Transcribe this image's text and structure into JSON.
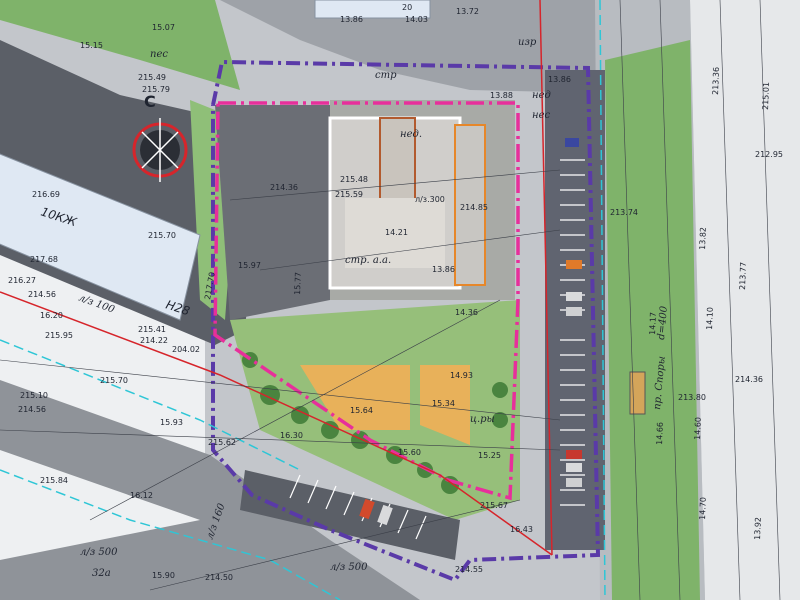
{
  "colors": {
    "road": "#4a4d55",
    "ground": "#a5a8ad",
    "green": "#7fb36a",
    "green_light": "#9fcb83",
    "playground": "#e8b15a",
    "building": "#c8c6c2",
    "boundary_magenta": "#e72f9b",
    "boundary_purple": "#5a3aa8",
    "red_line": "#d6252b",
    "cyan_line": "#2ec6d6"
  },
  "compass": {
    "letter": "С",
    "icon": "north-arrow-icon"
  },
  "buildings": [
    {
      "label": "10КЖ"
    },
    {
      "label": "Н28"
    },
    {
      "label": "20"
    }
  ],
  "main_building": {
    "label": "14.21",
    "top_label": "нед.",
    "mid_label": "л/з.300"
  },
  "labels": {
    "l1": "15.07",
    "l2": "15.15",
    "l3": "215.49",
    "l4": "215.79",
    "l5": "216.69",
    "l6": "215.70",
    "l7": "217.68",
    "l8": "216.27",
    "l9": "214.56",
    "l10": "16.20",
    "l11": "215.95",
    "l12": "215.41",
    "l13": "214.22",
    "l14": "204.02",
    "l15": "215.10",
    "l16": "214.56",
    "l17": "215.70",
    "l18": "15.93",
    "l19": "16.12",
    "l20": "15.90",
    "l21": "214.50",
    "l22": "215.84",
    "l23": "13.86",
    "l24": "14.03",
    "l25": "13.72",
    "l26": "13.86",
    "l27": "13.88",
    "l28": "214.36",
    "l29": "215.48",
    "l30": "215.59",
    "l31": "13.86",
    "l32": "14.36",
    "l33": "14.93",
    "l34": "15.34",
    "l35": "15.64",
    "l36": "15.25",
    "l37": "215.67",
    "l38": "16.43",
    "l39": "214.55",
    "l40": "15.60",
    "l41": "214.85",
    "l42": "213.74",
    "l43": "14.17",
    "l44": "14.66",
    "l45": "14.60",
    "l46": "14.70",
    "l47": "13.82",
    "l48": "213.77",
    "l49": "214.36",
    "l50": "213.80",
    "l51": "212.95",
    "l52": "215.01",
    "l53": "213.36",
    "l54": "14.10",
    "l55": "13.92",
    "l56": "215.62",
    "l57": "15.97",
    "l58": "15.77",
    "l59": "217.70",
    "l60": "16.30"
  },
  "annotations": {
    "pipe1": "л/з 500",
    "pipe2": "л/з 500",
    "pipe3": "л/з 160",
    "pipe4": "л/з 100",
    "road_right": "пр. Споры",
    "d400": "d=400",
    "strp": "стр",
    "izr": "изр",
    "nes": "нес",
    "ned": "нед",
    "spor": "пес",
    "stroy": "стр. а.а.",
    "tree": "ц.ры",
    "kz": "32а"
  }
}
